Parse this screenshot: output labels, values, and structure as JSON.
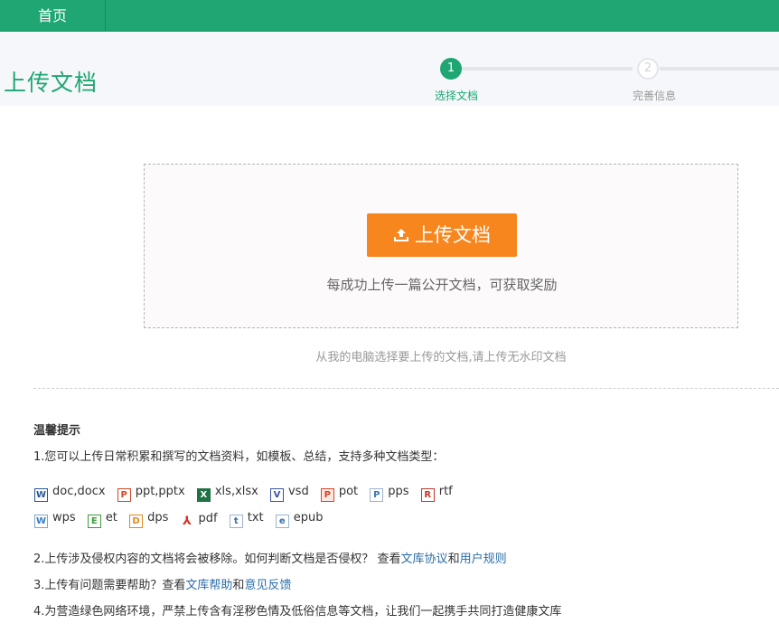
{
  "nav": {
    "home_label": "首页"
  },
  "page": {
    "title": "上传文档"
  },
  "steps": [
    {
      "number": "1",
      "label": "选择文档",
      "state": "active"
    },
    {
      "number": "2",
      "label": "完善信息",
      "state": "pending"
    }
  ],
  "upload": {
    "button_label": "上传文档",
    "reward_text": "每成功上传一篇公开文档，可获取奖励",
    "subnote": "从我的电脑选择要上传的文档,请上传无水印文档"
  },
  "tips": {
    "title": "温馨提示",
    "line1": "1.您可以上传日常积累和撰写的文档资料，如模板、总结，支持多种文档类型：",
    "line2_prefix": "2.上传涉及侵权内容的文档将会被移除。如何判断文档是否侵权？ 查看",
    "line2_link1": "文库协议",
    "line2_mid": "和",
    "line2_link2": "用户规则",
    "line3_prefix": "3.上传有问题需要帮助？查看",
    "line3_link1": "文库帮助",
    "line3_mid": "和",
    "line3_link2": "意见反馈",
    "line4": "4.为营造绿色网络环境，严禁上传含有淫秽色情及低俗信息等文档，让我们一起携手共同打造健康文库"
  },
  "file_types": {
    "row1": [
      {
        "icon": "word-icon",
        "glyph": "W",
        "label": "doc,docx"
      },
      {
        "icon": "ppt-icon",
        "glyph": "P",
        "label": "ppt,pptx"
      },
      {
        "icon": "xls-icon",
        "glyph": "X",
        "label": "xls,xlsx"
      },
      {
        "icon": "vsd-icon",
        "glyph": "V",
        "label": "vsd"
      },
      {
        "icon": "pot-icon",
        "glyph": "P",
        "label": "pot"
      },
      {
        "icon": "pps-icon",
        "glyph": "P",
        "label": "pps"
      },
      {
        "icon": "rtf-icon",
        "glyph": "R",
        "label": "rtf"
      }
    ],
    "row2": [
      {
        "icon": "wps-icon",
        "glyph": "W",
        "label": "wps"
      },
      {
        "icon": "et-icon",
        "glyph": "E",
        "label": "et"
      },
      {
        "icon": "dps-icon",
        "glyph": "D",
        "label": "dps"
      },
      {
        "icon": "pdf-icon",
        "glyph": "⅄",
        "label": "pdf"
      },
      {
        "icon": "txt-icon",
        "glyph": "t",
        "label": "txt"
      },
      {
        "icon": "epub-icon",
        "glyph": "e",
        "label": "epub"
      }
    ]
  },
  "colors": {
    "brand_green": "#1fa672",
    "upload_orange": "#f8861f",
    "link_blue": "#2b6da8"
  }
}
